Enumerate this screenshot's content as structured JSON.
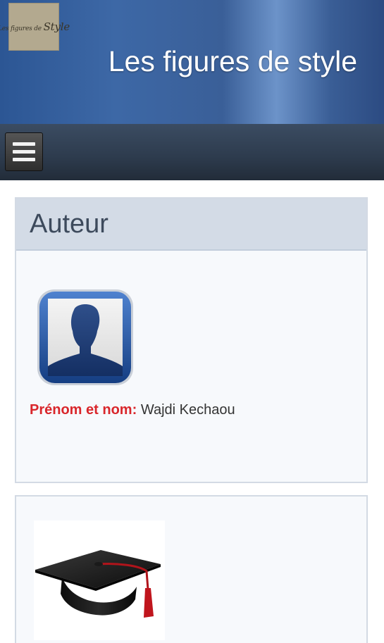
{
  "header": {
    "logo_small_text": "Les figures de",
    "logo_big_text": "Style",
    "title": "Les figures de style"
  },
  "navbar": {
    "menu_icon": "hamburger-menu-icon"
  },
  "author_panel": {
    "heading": "Auteur",
    "avatar_icon": "user-avatar-icon",
    "name_label": "Prénom et nom:",
    "name_value": "Wajdi Kechaou"
  },
  "education_panel": {
    "icon": "graduation-cap-icon"
  },
  "colors": {
    "header_blue": "#3d68a6",
    "navbar_dark": "#2d3b4d",
    "label_red": "#d9262b",
    "panel_head_bg": "#d3dbe6"
  }
}
